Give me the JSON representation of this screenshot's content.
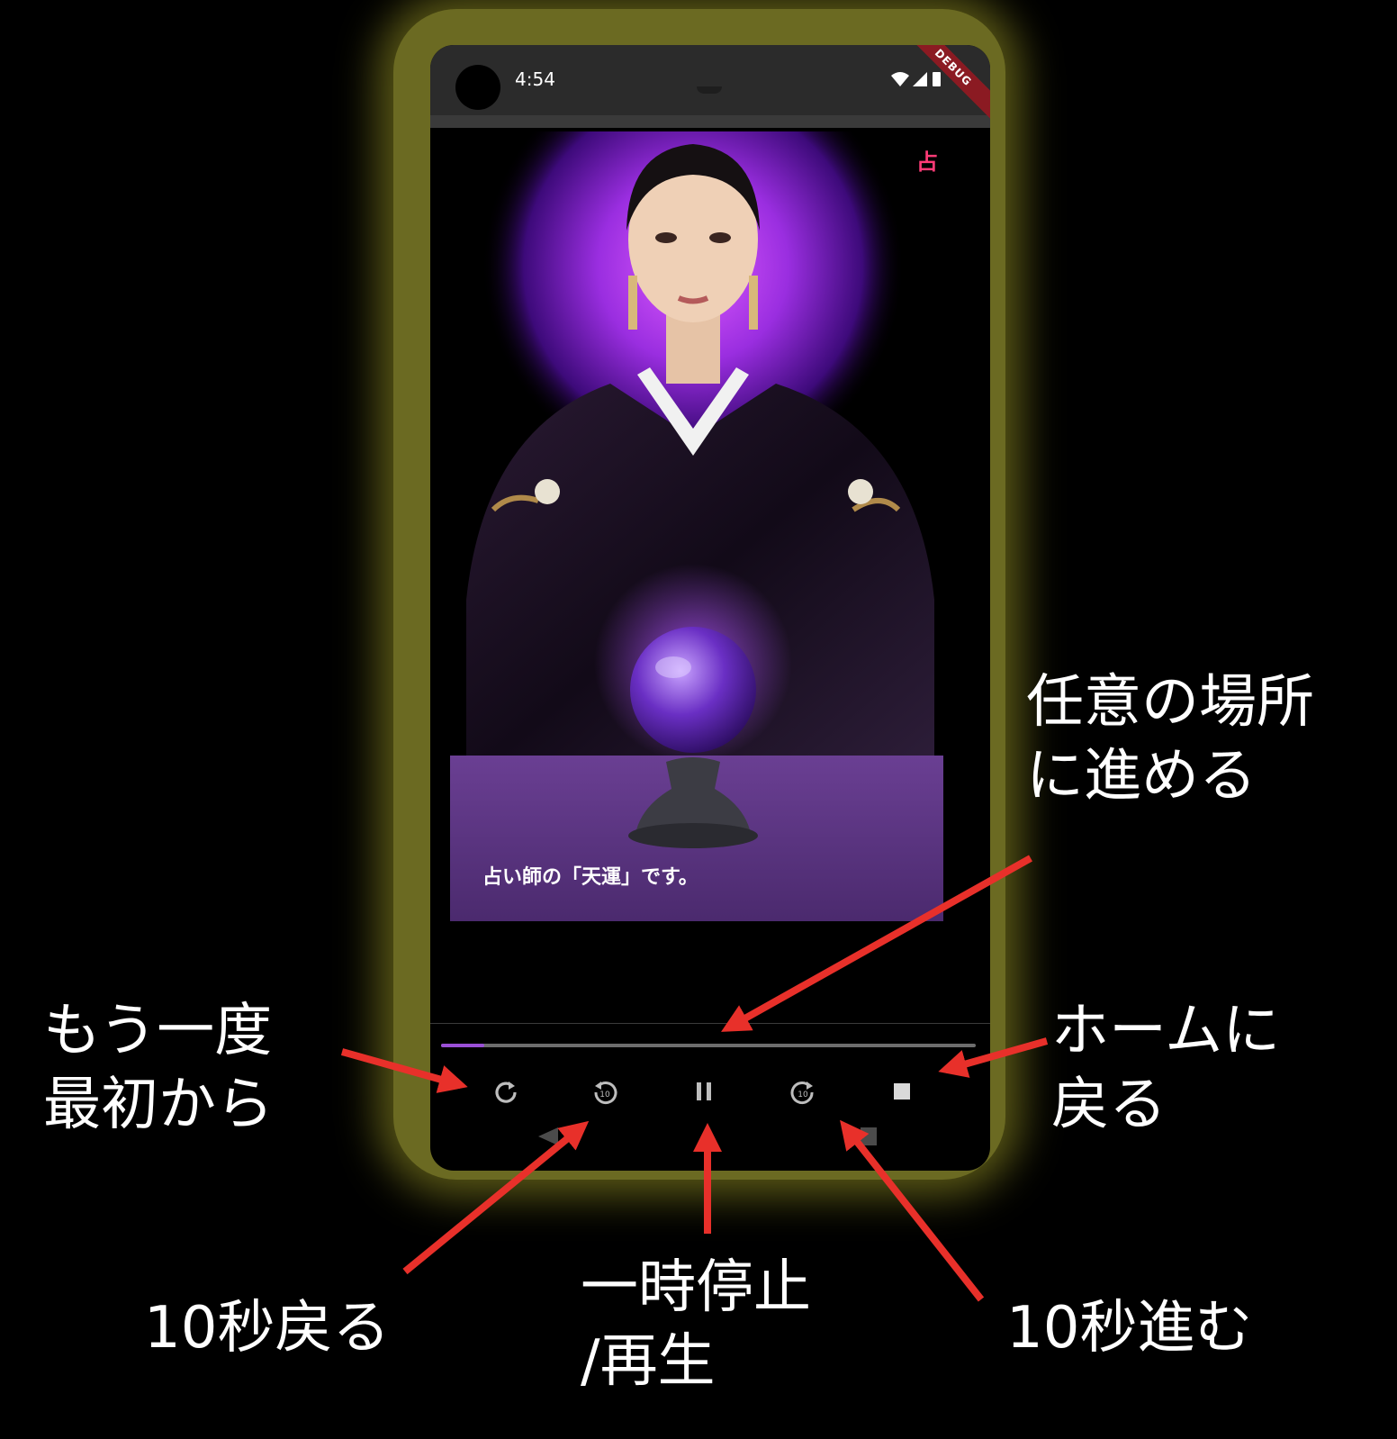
{
  "status_bar": {
    "time": "4:54",
    "debug_label": "DEBUG"
  },
  "app": {
    "badge": "占",
    "caption": "占い師の「天運」です。"
  },
  "player": {
    "progress": 0.08,
    "controls": [
      {
        "name": "restart-icon"
      },
      {
        "name": "rewind-10-icon"
      },
      {
        "name": "pause-icon"
      },
      {
        "name": "forward-10-icon"
      },
      {
        "name": "stop-icon"
      }
    ],
    "replay_10_label": "10"
  },
  "annotations": {
    "seek": [
      "任意の場所",
      "に進める"
    ],
    "restart": [
      "もう一度",
      "最初から"
    ],
    "home": [
      "ホームに",
      "戻る"
    ],
    "rewind": "10秒戻る",
    "pause": [
      "一時停止",
      "/再生"
    ],
    "forward": "10秒進む"
  },
  "colors": {
    "frame_glow": "#6b6a22",
    "arrow": "#e8302a",
    "badge": "#ff3b77",
    "accent_purple": "#9a4fd6"
  }
}
